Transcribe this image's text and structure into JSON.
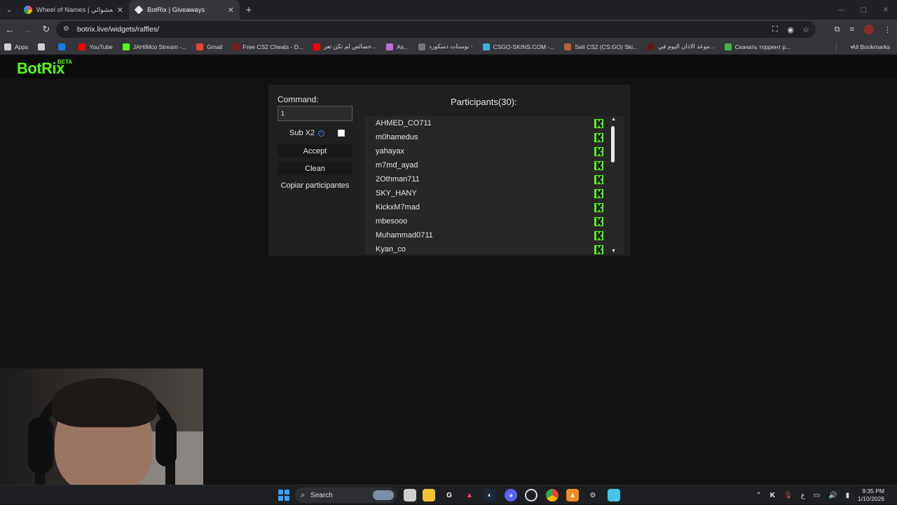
{
  "browser": {
    "tabs": [
      {
        "title": "Wheel of Names | نيم العشوائي",
        "active": false,
        "favicon_color": "#e2574c"
      },
      {
        "title": "BotRix | Giveaways",
        "active": true,
        "favicon_color": "#e6e6e6"
      }
    ],
    "url": "botrix.live/widgets/raffles/",
    "bookmarks": [
      {
        "label": "Apps",
        "icon": "apps-grid-icon",
        "color": "#cfcfcf"
      },
      {
        "label": "",
        "icon": "grid-icon",
        "color": "#cfcfcf"
      },
      {
        "label": "",
        "icon": "facebook-icon",
        "color": "#1877f2"
      },
      {
        "label": "YouTube",
        "icon": "youtube-icon",
        "color": "#ff0000"
      },
      {
        "label": "JAHIMco Stream -...",
        "icon": "kick-icon",
        "color": "#53fc18"
      },
      {
        "label": "Gmail",
        "icon": "gmail-icon",
        "color": "#ea4335"
      },
      {
        "label": "Free CS2 Cheats - D...",
        "icon": "site-icon",
        "color": "#7a1d1d"
      },
      {
        "label": "خصائص لم تكن تعر...",
        "icon": "youtube-icon",
        "color": "#ff0000"
      },
      {
        "label": "As...",
        "icon": "gem-icon",
        "color": "#c06bd8"
      },
      {
        "label": "بوستات دسكورد -",
        "icon": "site-icon",
        "color": "#777777"
      },
      {
        "label": "CSGO-SKINS.COM -...",
        "icon": "site-icon",
        "color": "#3fb0d8"
      },
      {
        "label": "Sell CS2 (CS:GO) Ski...",
        "icon": "site-icon",
        "color": "#b4623a"
      },
      {
        "label": "موعد الاذان اليوم في...",
        "icon": "site-icon",
        "color": "#5a1a1a"
      },
      {
        "label": "Скачать торрент р...",
        "icon": "site-icon",
        "color": "#4caf50"
      }
    ],
    "all_bookmarks": "All Bookmarks"
  },
  "site": {
    "logo": "BotRix",
    "logo_badge": "BETA"
  },
  "raffle": {
    "command_label": "Command:",
    "command_value": "1",
    "sub_x2_label": "Sub X2",
    "sub_x2_checked": false,
    "accept_label": "Accept",
    "clean_label": "Clean",
    "copy_label": "Copiar participantes",
    "participants_title": "Participants(30):",
    "participants": [
      {
        "name": "AHMED_CO711",
        "platform": "kick"
      },
      {
        "name": "m0hamedus",
        "platform": "kick"
      },
      {
        "name": "yahayax",
        "platform": "kick"
      },
      {
        "name": "m7md_ayad",
        "platform": "kick"
      },
      {
        "name": "2Othman711",
        "platform": "kick"
      },
      {
        "name": "SKY_HANY",
        "platform": "kick"
      },
      {
        "name": "KickxM7mad",
        "platform": "kick"
      },
      {
        "name": "mbesooo",
        "platform": "kick"
      },
      {
        "name": "Muhammad0711",
        "platform": "kick"
      },
      {
        "name": "Kyan_co",
        "platform": "kick"
      }
    ],
    "accent_color": "#53fc18"
  },
  "taskbar": {
    "search_label": "Search",
    "time": "9:35 PM",
    "date": "1/10/2026",
    "lang": "ع"
  }
}
